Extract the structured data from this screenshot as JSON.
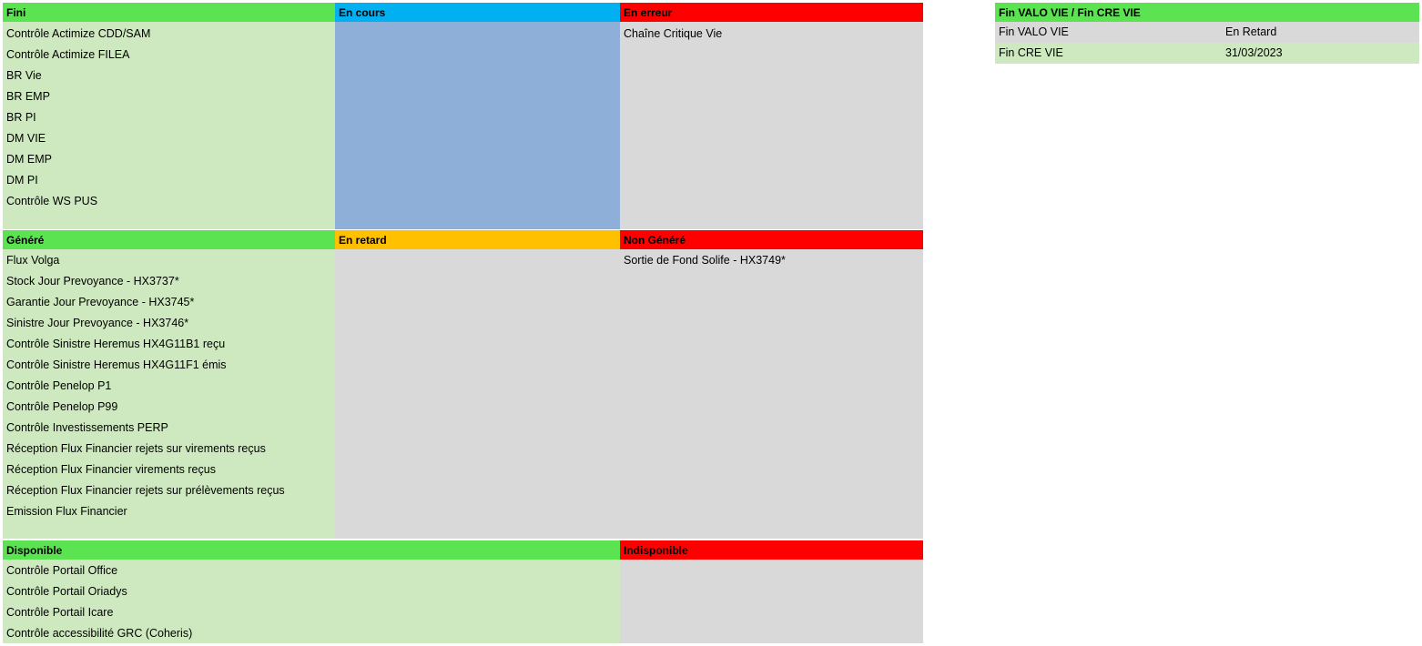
{
  "section1": {
    "fini": {
      "header": "Fini",
      "items": [
        "Contrôle Actimize CDD/SAM",
        "Contrôle Actimize FILEA",
        "BR Vie",
        "BR EMP",
        "BR PI",
        "DM VIE",
        "DM EMP",
        "DM PI",
        "Contrôle WS PUS"
      ]
    },
    "en_cours": {
      "header": "En cours",
      "items": []
    },
    "en_erreur": {
      "header": "En erreur",
      "items": [
        "Chaîne Critique Vie"
      ]
    }
  },
  "section2": {
    "genere": {
      "header": "Généré",
      "items": [
        "Flux Volga",
        "Stock Jour Prevoyance - HX3737*",
        "Garantie Jour Prevoyance - HX3745*",
        "Sinistre Jour Prevoyance - HX3746*",
        "Contrôle Sinistre Heremus HX4G11B1 reçu",
        "Contrôle Sinistre Heremus HX4G11F1 émis",
        "Contrôle Penelop P1",
        "Contrôle Penelop P99",
        "Contrôle Investissements PERP",
        "Réception Flux Financier rejets sur virements reçus",
        "Réception Flux Financier virements reçus",
        "Réception Flux Financier rejets sur prélèvements reçus",
        "Emission Flux Financier"
      ]
    },
    "en_retard": {
      "header": "En retard",
      "items": []
    },
    "non_genere": {
      "header": "Non Généré",
      "items": [
        "Sortie de Fond Solife - HX3749*"
      ]
    }
  },
  "section3": {
    "disponible": {
      "header": "Disponible",
      "items": [
        "Contrôle Portail Office",
        "Contrôle Portail Oriadys",
        "Contrôle Portail Icare",
        "Contrôle accessibilité GRC (Coheris)"
      ]
    },
    "indisponible": {
      "header": "Indisponible",
      "items": []
    }
  },
  "summary": {
    "header": "Fin VALO VIE / Fin CRE VIE",
    "rows": [
      {
        "label": "Fin VALO VIE",
        "value": "En Retard"
      },
      {
        "label": "Fin CRE VIE",
        "value": "31/03/2023"
      }
    ]
  },
  "colors": {
    "green_header": "#5ce352",
    "blue_header": "#00b0f0",
    "red_header": "#ff0000",
    "orange_header": "#ffc000",
    "green_body": "#cee9bf",
    "blue_body": "#8eb0d8",
    "grey_body": "#d9d9d9"
  }
}
